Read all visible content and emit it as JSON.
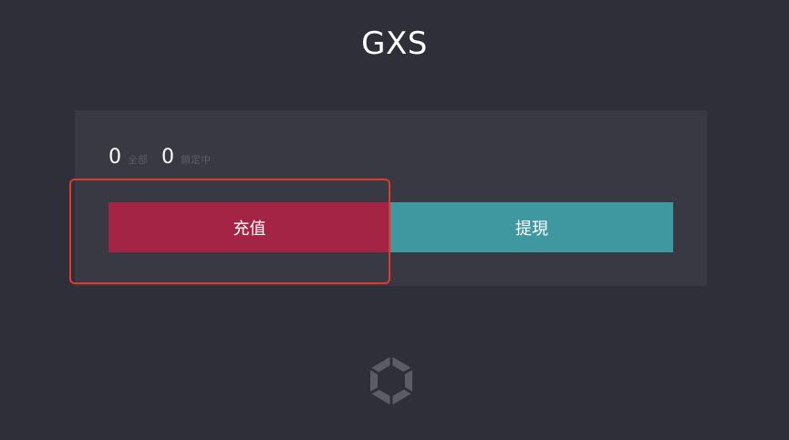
{
  "header": {
    "title": "GXS"
  },
  "balances": {
    "total_value": "0",
    "total_label": "全部",
    "locked_value": "0",
    "locked_label": "鎖定中"
  },
  "actions": {
    "deposit_label": "充值",
    "withdraw_label": "提現"
  },
  "logo": {
    "icon": "gxs-logo-icon"
  },
  "colors": {
    "background": "#2e2f39",
    "card": "#383943",
    "deposit_button": "#a32445",
    "withdraw_button": "#3f979f",
    "highlight": "#e2392f",
    "logo": "#5a5d68"
  }
}
